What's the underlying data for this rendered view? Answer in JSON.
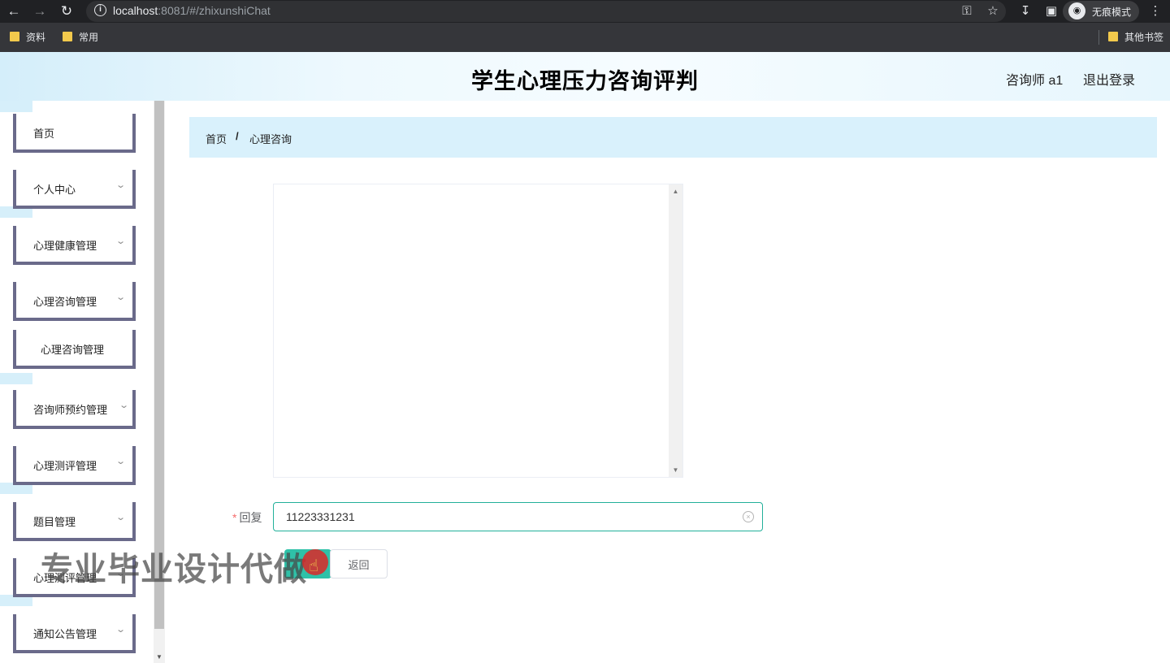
{
  "browser": {
    "url_host": "localhost",
    "url_rest": ":8081/#/zhixunshiChat",
    "incognito_label": "无痕模式",
    "bookmarks": [
      "资料",
      "常用"
    ],
    "other_bookmarks": "其他书签"
  },
  "header": {
    "title": "学生心理压力咨询评判",
    "user": "咨询师 a1",
    "logout": "退出登录"
  },
  "sidebar": {
    "items": [
      {
        "label": "首页",
        "has_children": false
      },
      {
        "label": "个人中心",
        "has_children": true
      },
      {
        "label": "心理健康管理",
        "has_children": true
      },
      {
        "label": "心理咨询管理",
        "has_children": true
      },
      {
        "label": "心理咨询管理",
        "sub": true
      },
      {
        "label": "咨询师预约管理",
        "has_children": true
      },
      {
        "label": "心理测评管理",
        "has_children": true
      },
      {
        "label": "题目管理",
        "has_children": true
      },
      {
        "label": "心理测评管理",
        "has_children": true
      },
      {
        "label": "通知公告管理",
        "has_children": true
      }
    ]
  },
  "breadcrumb": {
    "home": "首页",
    "separator": "/",
    "current": "心理咨询"
  },
  "form": {
    "reply_label": "回复",
    "required_mark": "*",
    "reply_value": "11223331231",
    "back_button": "返回"
  },
  "overlay": {
    "watermark": "专业毕业设计代做"
  },
  "colors": {
    "accent": "#2fc1a8",
    "menu_border": "#6a6a8a",
    "breadcrumb_bg": "#d9f1fc"
  }
}
